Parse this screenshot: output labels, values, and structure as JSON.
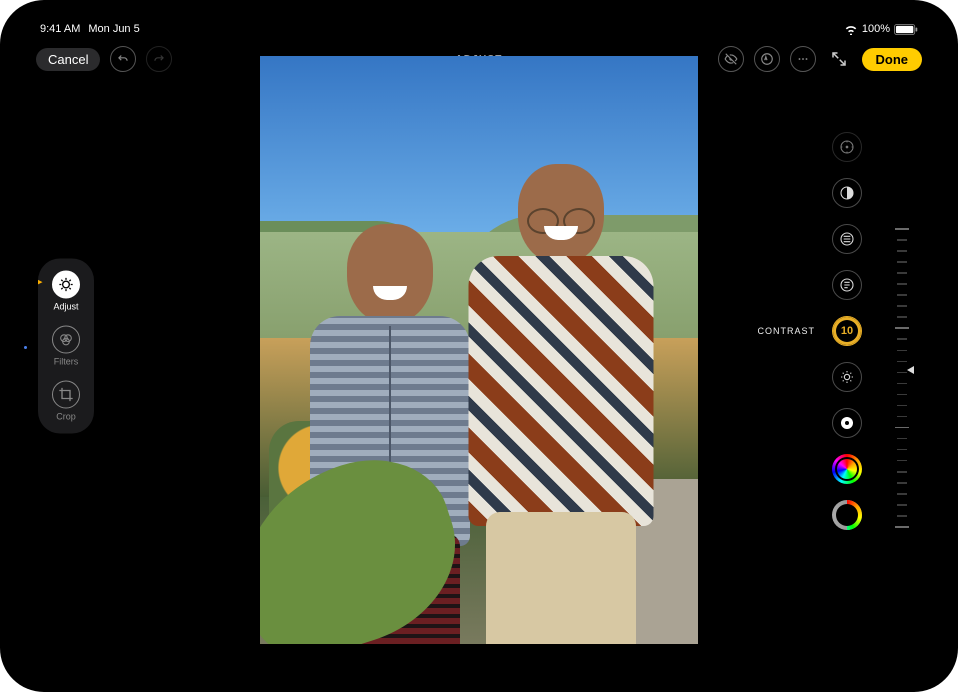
{
  "status": {
    "time": "9:41 AM",
    "date": "Mon Jun 5",
    "battery_pct": "100%"
  },
  "toolbar": {
    "cancel": "Cancel",
    "mode_title": "ADJUST",
    "done": "Done"
  },
  "dock": {
    "adjust": "Adjust",
    "filters": "Filters",
    "crop": "Crop"
  },
  "adjust": {
    "selected_label": "CONTRAST",
    "selected_value": "10",
    "items": [
      {
        "id": "auto",
        "name": "auto-enhance-icon"
      },
      {
        "id": "exposure",
        "name": "exposure-icon"
      },
      {
        "id": "brilliance",
        "name": "brilliance-icon"
      },
      {
        "id": "highlights",
        "name": "highlights-icon"
      },
      {
        "id": "contrast",
        "name": "contrast-icon"
      },
      {
        "id": "brightness",
        "name": "brightness-icon"
      },
      {
        "id": "blackpoint",
        "name": "black-point-icon"
      },
      {
        "id": "saturation",
        "name": "saturation-icon"
      },
      {
        "id": "vibrance",
        "name": "vibrance-icon"
      }
    ]
  }
}
